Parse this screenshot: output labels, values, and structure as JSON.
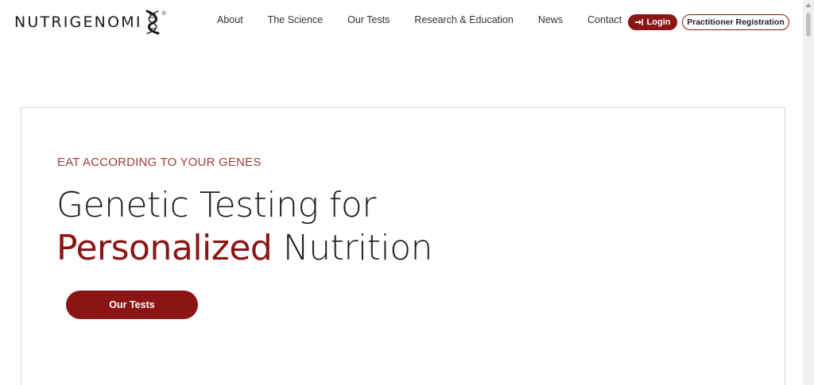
{
  "brand": {
    "name": "NUTRIGENOMI",
    "registered": "®",
    "accent_color": "#8b1414"
  },
  "nav": {
    "items": [
      {
        "label": "About"
      },
      {
        "label": "The Science"
      },
      {
        "label": "Our Tests"
      },
      {
        "label": "Research & Education"
      },
      {
        "label": "News"
      },
      {
        "label": "Contact"
      }
    ]
  },
  "header_actions": {
    "login_label": "Login",
    "login_icon": "sign-in-icon",
    "practitioner_label": "Practitioner Registration"
  },
  "hero": {
    "eyebrow": "EAT ACCORDING TO YOUR GENES",
    "headline_line1": "Genetic Testing for",
    "headline_accent": "Personalized",
    "headline_rest": " Nutrition",
    "cta_label": "Our Tests"
  }
}
